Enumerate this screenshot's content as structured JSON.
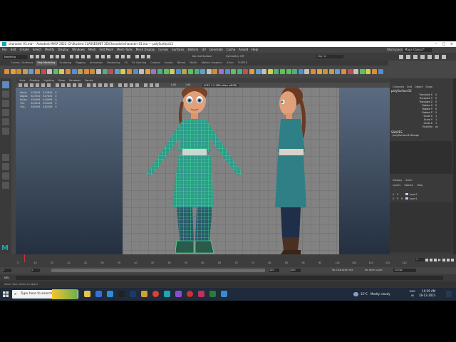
{
  "window": {
    "title": "character 03.mb* - Autodesk MAYA 2022: D:\\Student CLASSES\\NIT 3D\\Character\\character 03.ma  ---  polySurface12",
    "menus": [
      "File",
      "Edit",
      "Create",
      "Select",
      "Modify",
      "Display",
      "Windows",
      "Mesh",
      "Edit Mesh",
      "Mesh Tools",
      "Mesh Display",
      "Curves",
      "Surfaces",
      "Deform",
      "UV",
      "Generate",
      "Cache",
      "Arnold",
      "Help"
    ],
    "workspace_label": "Workspace:",
    "workspace_value": "Maya Classic*",
    "mode": "Modeling",
    "no_live_surface": "No Live Surface",
    "symmetry": "Symmetry: Off",
    "sign_in": "Sign In"
  },
  "shelf": {
    "tabs": [
      "Curves / Surfaces",
      "Poly Modeling",
      "Sculpting",
      "Rigging",
      "Animation",
      "Rendering",
      "FX",
      "FX Caching",
      "Custom",
      "Arnold",
      "Bifrost",
      "MASH",
      "Motion Graphics",
      "XGen",
      "TURTLE"
    ],
    "active_tab": "Poly Modeling"
  },
  "viewport": {
    "panel_menus": [
      "View",
      "Shading",
      "Lighting",
      "Show",
      "Renderer",
      "Panels"
    ],
    "camera_label": "ACES 1.0 SDR-video (sRGB)",
    "gamma": "1.00",
    "exposure": "0.00",
    "hud": {
      "rows": [
        {
          "label": "Verts:",
          "a": "412834",
          "b": "412834",
          "c": "0"
        },
        {
          "label": "Edges:",
          "a": "817630",
          "b": "817630",
          "c": "0"
        },
        {
          "label": "Faces:",
          "a": "404996",
          "b": "404996",
          "c": "0"
        },
        {
          "label": "Tris:",
          "a": "813424",
          "b": "813424",
          "c": "0"
        },
        {
          "label": "UVs:",
          "a": "482306",
          "b": "482306",
          "c": "0"
        }
      ]
    }
  },
  "channel_box": {
    "tabs": [
      "Channels",
      "Edit",
      "Object",
      "Show"
    ],
    "object": "polySurface12",
    "attributes": [
      {
        "name": "Translate X",
        "value": "0"
      },
      {
        "name": "Translate Y",
        "value": "0"
      },
      {
        "name": "Translate Z",
        "value": "0"
      },
      {
        "name": "Rotate X",
        "value": "0"
      },
      {
        "name": "Rotate Y",
        "value": "0"
      },
      {
        "name": "Rotate Z",
        "value": "0"
      },
      {
        "name": "Scale X",
        "value": "1"
      },
      {
        "name": "Scale Y",
        "value": "1"
      },
      {
        "name": "Scale Z",
        "value": "1"
      },
      {
        "name": "Visibility",
        "value": "on"
      }
    ],
    "shapes_header": "SHAPES",
    "shape_name": "polySurface12Shape",
    "layer_tabs": [
      "Display",
      "Anim"
    ],
    "layer_menus": [
      "Layers",
      "Options",
      "Help"
    ],
    "layers": [
      {
        "v": "V",
        "p": "P",
        "r": "",
        "name": "layer2"
      },
      {
        "v": "V",
        "p": "P",
        "r": "R",
        "name": "layer1"
      }
    ]
  },
  "timeline": {
    "ticks": [
      "5",
      "10",
      "15",
      "20",
      "25",
      "30",
      "35",
      "40",
      "45",
      "50",
      "55",
      "60",
      "65",
      "70",
      "75",
      "80",
      "85",
      "90",
      "95",
      "100",
      "105",
      "110",
      "115",
      "120"
    ],
    "current_frame": "1",
    "range_start": "1",
    "range_inner_start": "1",
    "range_inner_end": "120",
    "range_end": "120",
    "range_outer_end": "200",
    "no_char_set": "No Character Set",
    "no_anim_layer": "No Anim Layer",
    "fps": "24 fps"
  },
  "command_line": {
    "mel_label": "MEL",
    "help_text": "Select Tool: select an object"
  },
  "taskbar": {
    "search_placeholder": "Type here to search",
    "weather_temp": "15°C",
    "weather_text": "Mostly cloudy",
    "lang": "ENG",
    "lang_sub": "IN",
    "time": "10:59 AM",
    "date": "28-12-2023"
  },
  "colors": {
    "maya_accent": "#1fa5b5",
    "wire_green": "#3cff7a",
    "model_teal": "#2f8f93"
  }
}
